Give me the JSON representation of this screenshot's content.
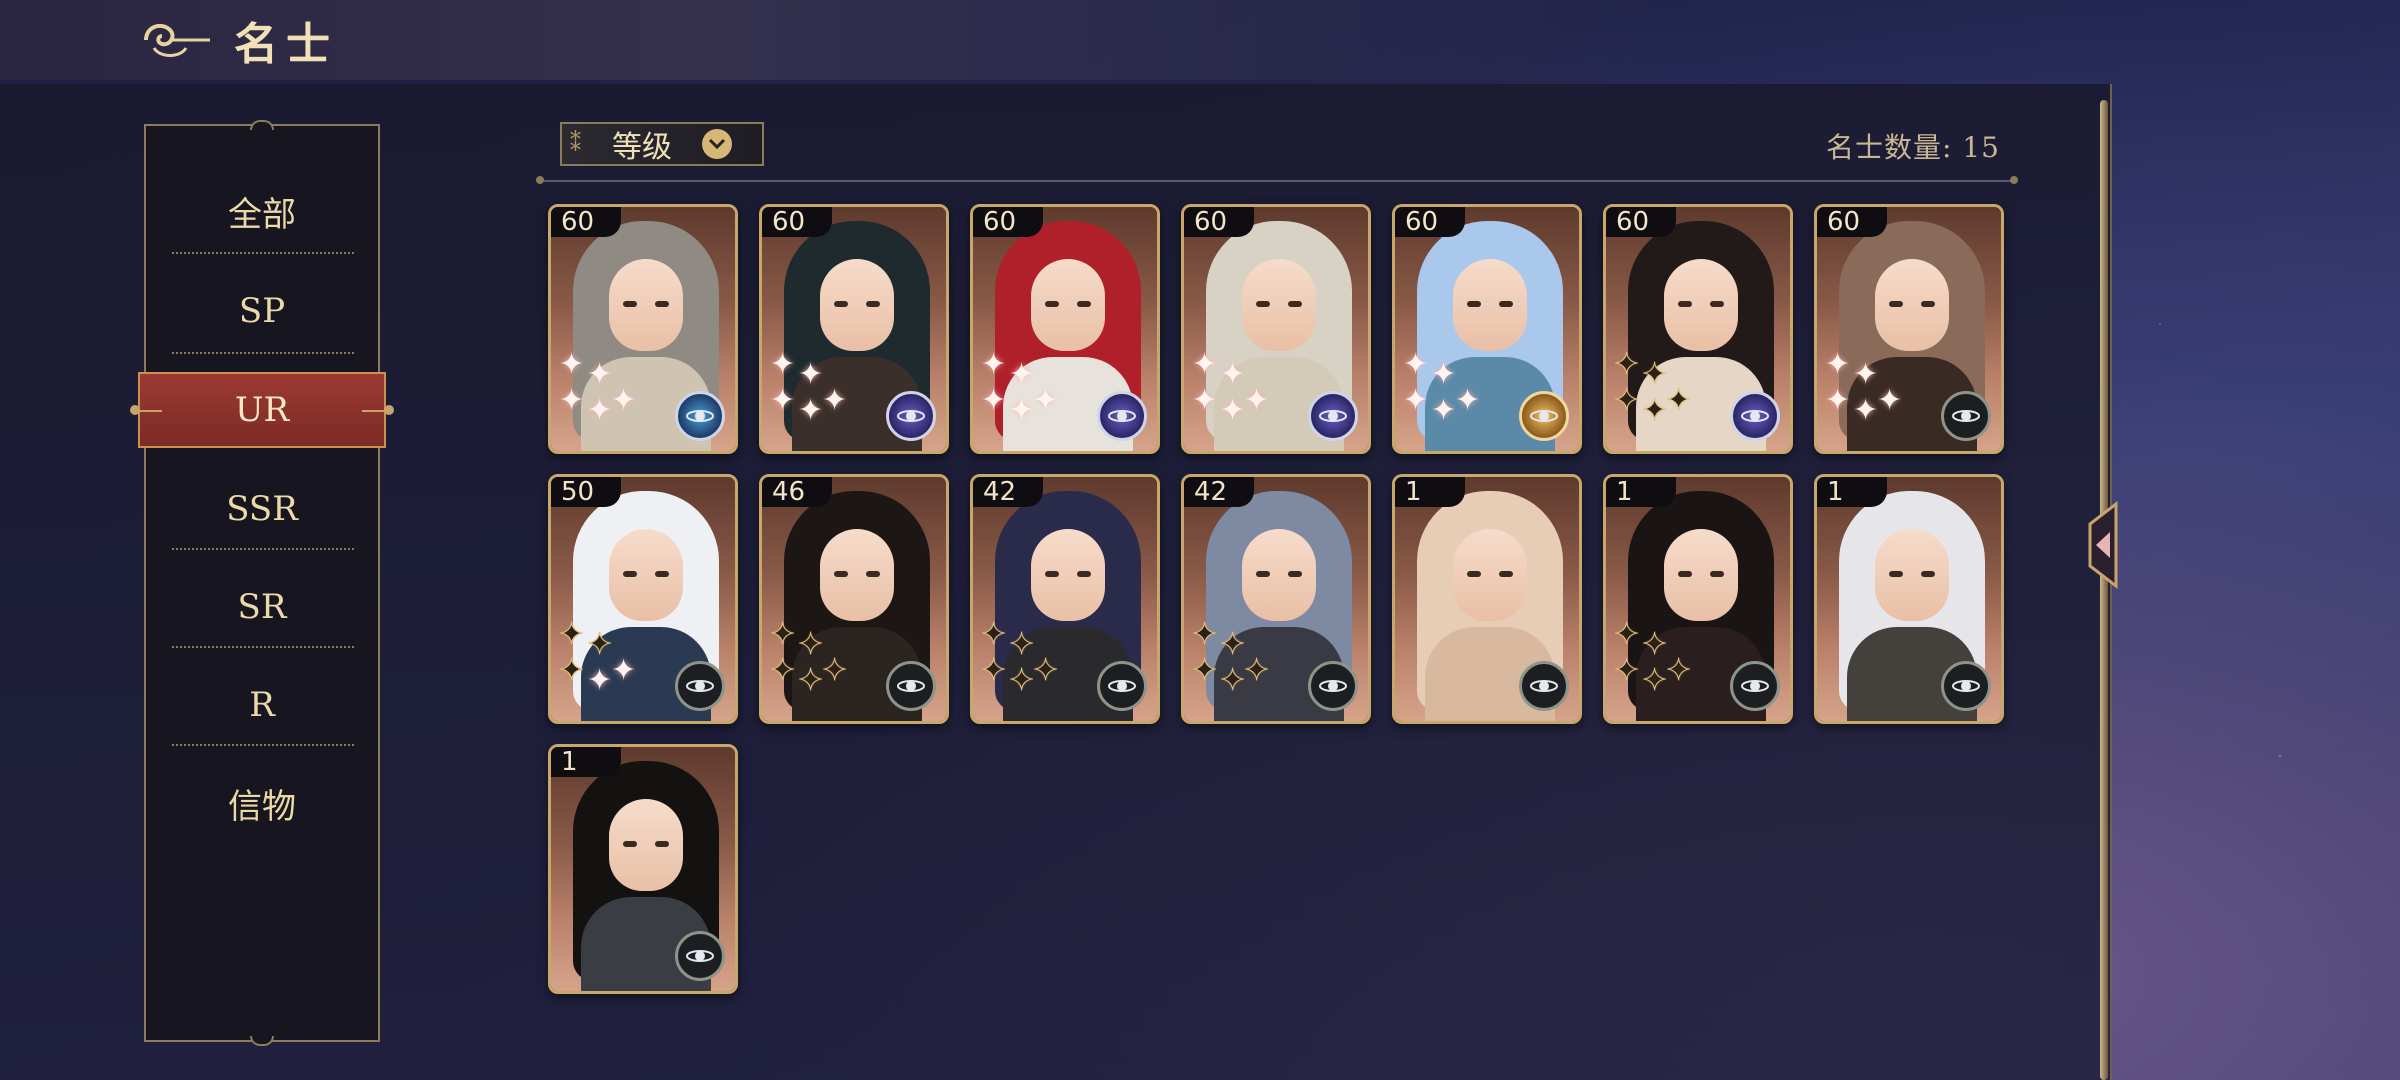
{
  "header": {
    "title": "名士",
    "icon": "cloud-swirl-icon"
  },
  "sidebar": {
    "items": [
      {
        "label": "全部"
      },
      {
        "label": "SP"
      },
      {
        "label": "UR"
      },
      {
        "label": "SSR"
      },
      {
        "label": "SR"
      },
      {
        "label": "R"
      },
      {
        "label": "信物"
      }
    ],
    "active_index": 2
  },
  "toolbar": {
    "sort_label": "等级",
    "count_label": "名士数量: 15"
  },
  "cards": [
    {
      "level": "60",
      "hair": "#8f8a84",
      "body": "#cfc4b2",
      "badge": "blue",
      "stars": "white"
    },
    {
      "level": "60",
      "hair": "#1e2a2e",
      "body": "#3a2f2a",
      "badge": "purple",
      "stars": "white"
    },
    {
      "level": "60",
      "hair": "#b0202a",
      "body": "#e8e2dc",
      "badge": "purple",
      "stars": "white"
    },
    {
      "level": "60",
      "hair": "#d8d2c4",
      "body": "#d4cab8",
      "badge": "purple",
      "stars": "white"
    },
    {
      "level": "60",
      "hair": "#a9c8ec",
      "body": "#5a8aa8",
      "badge": "gold",
      "stars": "white"
    },
    {
      "level": "60",
      "hair": "#221a18",
      "body": "#e6d6c6",
      "badge": "purple",
      "stars": "gold"
    },
    {
      "level": "60",
      "hair": "#8a6a58",
      "body": "#3a2a24",
      "badge": "plain",
      "stars": "white"
    },
    {
      "level": "50",
      "hair": "#eef0f4",
      "body": "#2a3a52",
      "badge": "plain",
      "stars": "mixed"
    },
    {
      "level": "46",
      "hair": "#1c1614",
      "body": "#2c2420",
      "badge": "plain",
      "stars": "gold"
    },
    {
      "level": "42",
      "hair": "#2a2a4a",
      "body": "#2a2a2e",
      "badge": "plain",
      "stars": "gold"
    },
    {
      "level": "42",
      "hair": "#7e8aa2",
      "body": "#3a3a44",
      "badge": "plain",
      "stars": "gold"
    },
    {
      "level": "1",
      "hair": "#e8cdb6",
      "body": "#d8b89e",
      "badge": "plain",
      "stars": "none"
    },
    {
      "level": "1",
      "hair": "#1a1414",
      "body": "#2a1e1e",
      "badge": "plain",
      "stars": "gold"
    },
    {
      "level": "1",
      "hair": "#e6e6ea",
      "body": "#44403c",
      "badge": "plain",
      "stars": "none"
    },
    {
      "level": "1",
      "hair": "#141210",
      "body": "#3a3d44",
      "badge": "plain",
      "stars": "none"
    }
  ]
}
